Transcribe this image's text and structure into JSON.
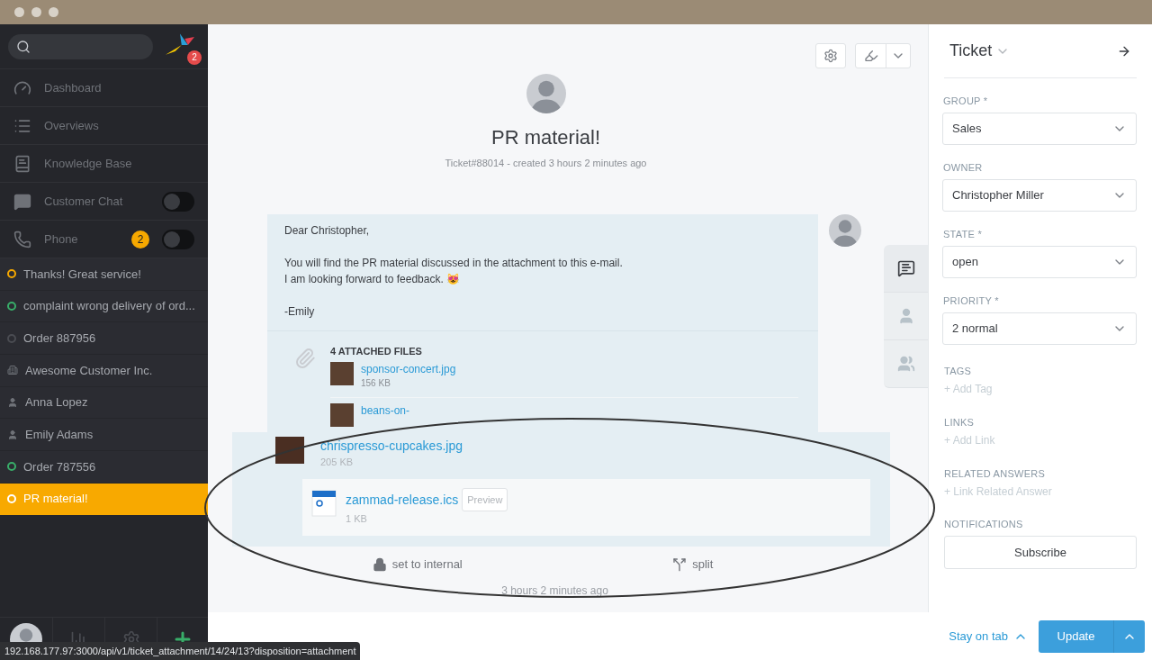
{
  "sidebar": {
    "logo_badge": "2",
    "nav": [
      {
        "kind": "dashboard",
        "label": "Dashboard"
      },
      {
        "kind": "overviews",
        "label": "Overviews"
      },
      {
        "kind": "knowledge",
        "label": "Knowledge Base"
      },
      {
        "kind": "chat",
        "label": "Customer Chat",
        "toggle": {
          "on": false
        }
      },
      {
        "kind": "phone",
        "label": "Phone",
        "badge": "2",
        "toggle": {
          "on": false
        }
      }
    ],
    "tasks": [
      {
        "kind": "ticket",
        "label": "Thanks! Great service!",
        "color": "#f6a800",
        "selected": false
      },
      {
        "kind": "ticket",
        "label": "complaint wrong delivery of ord...",
        "color": "#38ad69",
        "selected": false
      },
      {
        "kind": "ticket",
        "label": "Order 887956",
        "color": "#4a4c52",
        "selected": false
      },
      {
        "kind": "organization",
        "label": "Awesome Customer Inc.",
        "selected": false
      },
      {
        "kind": "user",
        "label": "Anna Lopez",
        "selected": false
      },
      {
        "kind": "user",
        "label": "Emily Adams",
        "selected": false
      },
      {
        "kind": "ticket",
        "label": "Order 787556",
        "color": "#38ad69",
        "selected": false
      },
      {
        "kind": "ticket",
        "label": "PR material!",
        "color": "#ffffff",
        "selected": true
      }
    ]
  },
  "ticket": {
    "title": "PR material!",
    "meta": "Ticket#88014 - created 3 hours 2 minutes ago",
    "article": {
      "paragraphs": [
        [
          "Dear Christopher,"
        ],
        [
          "You will find the PR material discussed in the attachment to this e-mail.",
          "I am looking forward to feedback. 😻"
        ],
        [
          "-Emily"
        ]
      ],
      "attachments_heading": "4 ATTACHED FILES",
      "attachments": [
        {
          "name": "sponsor-concert.jpg",
          "size": "156 KB"
        },
        {
          "name": "beans-on-"
        }
      ]
    },
    "callout_attachments": [
      {
        "kind": "image",
        "name": "chrispresso-cupcakes.jpg",
        "size": "205 KB"
      },
      {
        "kind": "calendar",
        "name": "zammad-release.ics",
        "size": "1 KB",
        "preview": "Preview"
      }
    ],
    "actions": [
      {
        "kind": "internal",
        "label": "set to internal"
      },
      {
        "kind": "split",
        "label": "split"
      }
    ],
    "time": "3 hours 2 minutes ago",
    "side_tabs": [
      {
        "kind": "article",
        "selected": true
      },
      {
        "kind": "customer",
        "selected": false
      },
      {
        "kind": "organization",
        "selected": false
      }
    ]
  },
  "panel": {
    "title": "Ticket",
    "fields": [
      {
        "label": "GROUP *",
        "value": "Sales"
      },
      {
        "label": "OWNER",
        "value": "Christopher Miller"
      },
      {
        "label": "STATE *",
        "value": "open"
      },
      {
        "label": "PRIORITY *",
        "value": "2 normal"
      }
    ],
    "sections": [
      {
        "label": "TAGS",
        "link": "+ Add Tag"
      },
      {
        "label": "LINKS",
        "link": "+ Add Link"
      },
      {
        "label": "RELATED ANSWERS",
        "link": "+ Link Related Answer"
      }
    ],
    "notifications": {
      "label": "NOTIFICATIONS",
      "button": "Subscribe"
    }
  },
  "footer": {
    "stay": "Stay on tab",
    "update": "Update"
  },
  "status_url": "192.168.177.97:3000/api/v1/ticket_attachment/14/24/13?disposition=attachment"
}
